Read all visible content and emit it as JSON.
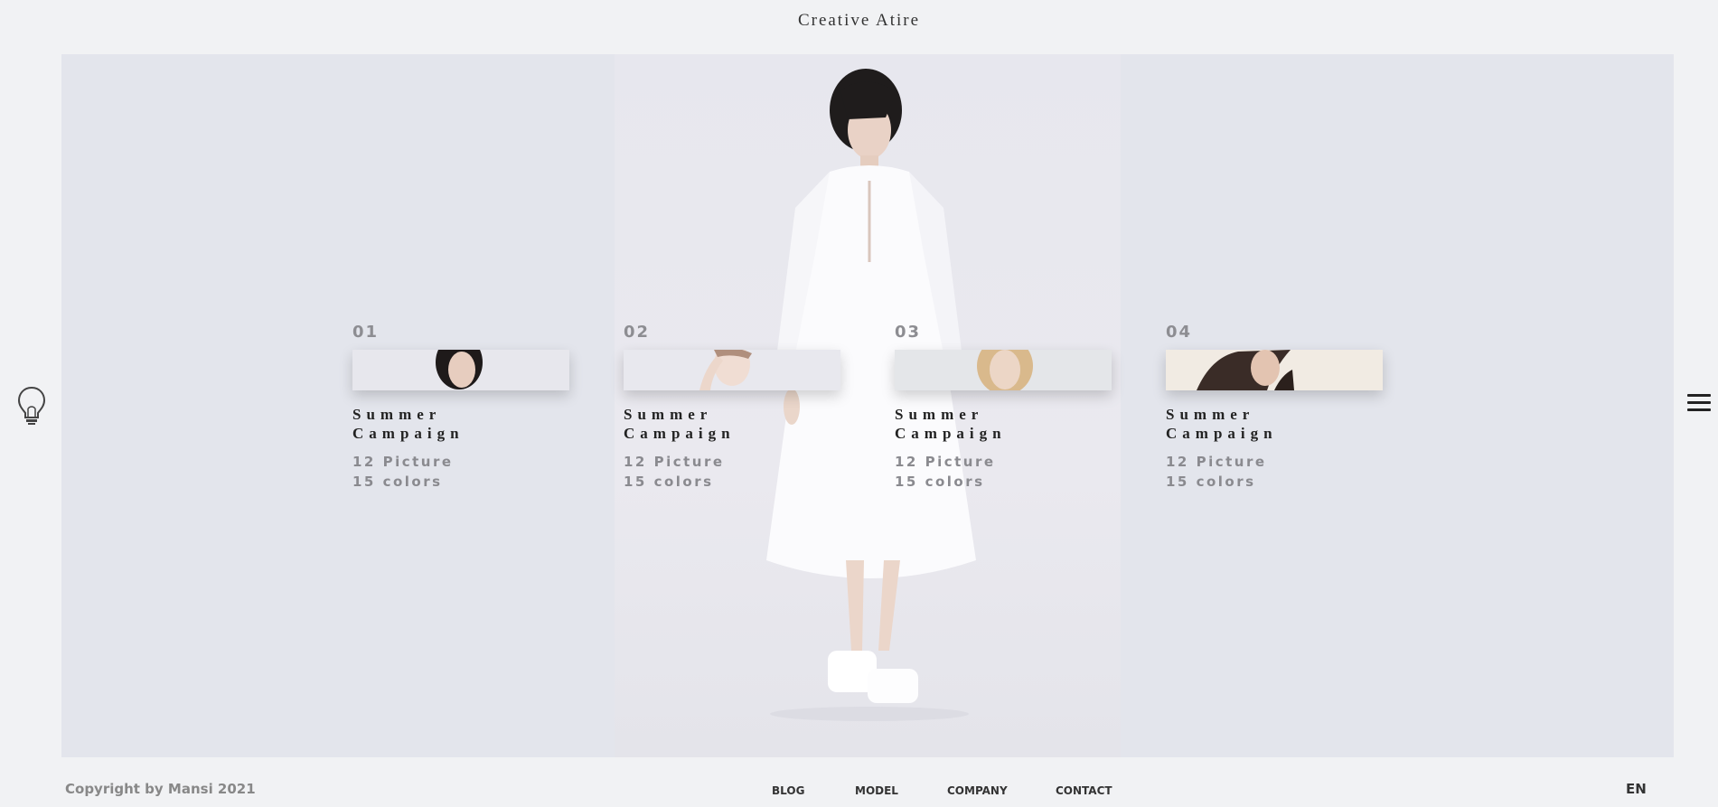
{
  "header": {
    "brand": "Creative Atire"
  },
  "icons": {
    "left": "lightbulb-icon",
    "right": "hamburger-menu-icon"
  },
  "cards": [
    {
      "number": "01",
      "title_line1": "Summer",
      "title_line2": "Campaign",
      "pictures": "12 Picture",
      "colors": "15 colors"
    },
    {
      "number": "02",
      "title_line1": "Summer",
      "title_line2": "Campaign",
      "pictures": "12 Picture",
      "colors": "15 colors"
    },
    {
      "number": "03",
      "title_line1": "Summer",
      "title_line2": "Campaign",
      "pictures": "12 Picture",
      "colors": "15 colors"
    },
    {
      "number": "04",
      "title_line1": "Summer",
      "title_line2": "Campaign",
      "pictures": "12 Picture",
      "colors": "15 colors"
    }
  ],
  "footer": {
    "copyright": "Copyright by Mansi 2021",
    "nav": [
      "BLOG",
      "MODEL",
      "COMPANY",
      "CONTACT"
    ],
    "language": "EN"
  },
  "colors": {
    "page_bg": "#f1f2f4",
    "hero_bg": "#e3e5ec",
    "text_dark": "#222222",
    "text_muted": "#8a8a8f"
  }
}
